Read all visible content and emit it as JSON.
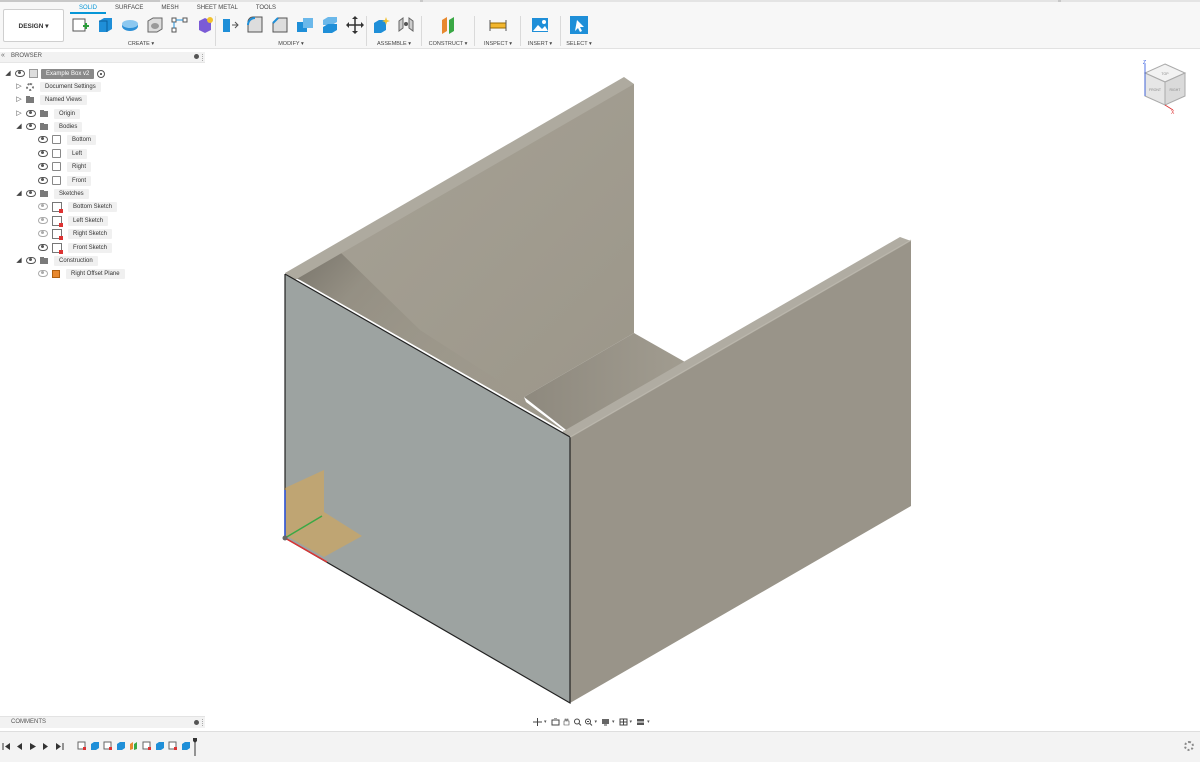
{
  "workspace": {
    "label": "DESIGN ▾"
  },
  "tabs": [
    {
      "label": "SOLID",
      "active": true
    },
    {
      "label": "SURFACE"
    },
    {
      "label": "MESH"
    },
    {
      "label": "SHEET METAL"
    },
    {
      "label": "TOOLS"
    }
  ],
  "toolbar_groups": {
    "create": "CREATE ▾",
    "modify": "MODIFY ▾",
    "assemble": "ASSEMBLE ▾",
    "construct": "CONSTRUCT ▾",
    "inspect": "INSPECT ▾",
    "insert": "INSERT ▾",
    "select": "SELECT ▾"
  },
  "browser": {
    "title": "BROWSER",
    "root": "Example Box v2",
    "items": {
      "document_settings": "Document Settings",
      "named_views": "Named Views",
      "origin": "Origin",
      "bodies": "Bodies",
      "bodies_children": [
        "Bottom",
        "Left",
        "Right",
        "Front"
      ],
      "sketches": "Sketches",
      "sketches_children": [
        "Bottom Sketch",
        "Left Sketch",
        "Right Sketch",
        "Front Sketch"
      ],
      "construction": "Construction",
      "construction_children": [
        "Right Offset Plane"
      ]
    }
  },
  "comments": {
    "title": "COMMENTS"
  },
  "viewcube": {
    "top": "TOP",
    "front": "FRONT",
    "right": "RIGHT",
    "axis_z": "Z",
    "axis_x": "X"
  },
  "colors": {
    "accent": "#0696d7",
    "model_front_face": "#9da3a1",
    "model_side_face": "#9a958a",
    "model_top_edge": "#aaa69c",
    "plane": "#e8a93c"
  },
  "icons": [
    "sketch-icon",
    "extrude-icon",
    "revolve-icon",
    "shell-icon",
    "pattern-icon",
    "joint-icon",
    "press-pull-icon",
    "fillet-icon",
    "chamfer-icon",
    "combine-icon",
    "split-icon",
    "move-icon",
    "new-component-icon",
    "joint-icon",
    "offset-plane-icon",
    "measure-icon",
    "insert-image-icon",
    "select-icon"
  ]
}
